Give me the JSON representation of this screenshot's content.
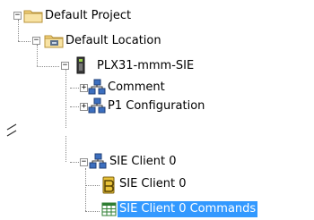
{
  "tree": {
    "project": {
      "label": "Default Project",
      "expanded": true,
      "icon": "folder-icon"
    },
    "location": {
      "label": "Default Location",
      "expanded": true,
      "icon": "location-folder-icon"
    },
    "module": {
      "label": "PLX31-mmm-SIE",
      "expanded": true,
      "icon": "module-icon"
    },
    "comment": {
      "label": "Comment",
      "expanded": false,
      "icon": "network-icon"
    },
    "p1config": {
      "label": "P1 Configuration",
      "expanded": false,
      "icon": "network-icon"
    },
    "client": {
      "label": "SIE Client 0",
      "expanded": true,
      "icon": "network-icon"
    },
    "client_settings": {
      "label": "SIE Client 0",
      "icon": "settings-icon"
    },
    "client_commands": {
      "label": "SIE Client 0 Commands",
      "icon": "grid-icon",
      "selected": true
    }
  },
  "colors": {
    "selection": "#3399ff",
    "folder": "#f3d27a",
    "network": "#3c6fbf"
  }
}
